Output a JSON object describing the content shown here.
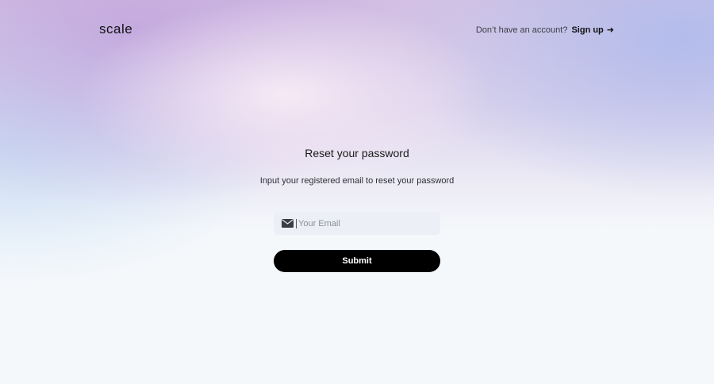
{
  "header": {
    "logo_text": "scale",
    "account_prompt": "Don’t have an account?",
    "signup_label": "Sign up",
    "signup_arrow": "➜"
  },
  "main": {
    "title": "Reset your password",
    "subtitle": "Input your registered email to reset your password",
    "email": {
      "icon": "mail-icon",
      "placeholder": "Your Email",
      "value": ""
    },
    "submit_label": "Submit"
  },
  "colors": {
    "button_background": "#000000",
    "button_text": "#ffffff",
    "input_background": "#eceff6"
  }
}
